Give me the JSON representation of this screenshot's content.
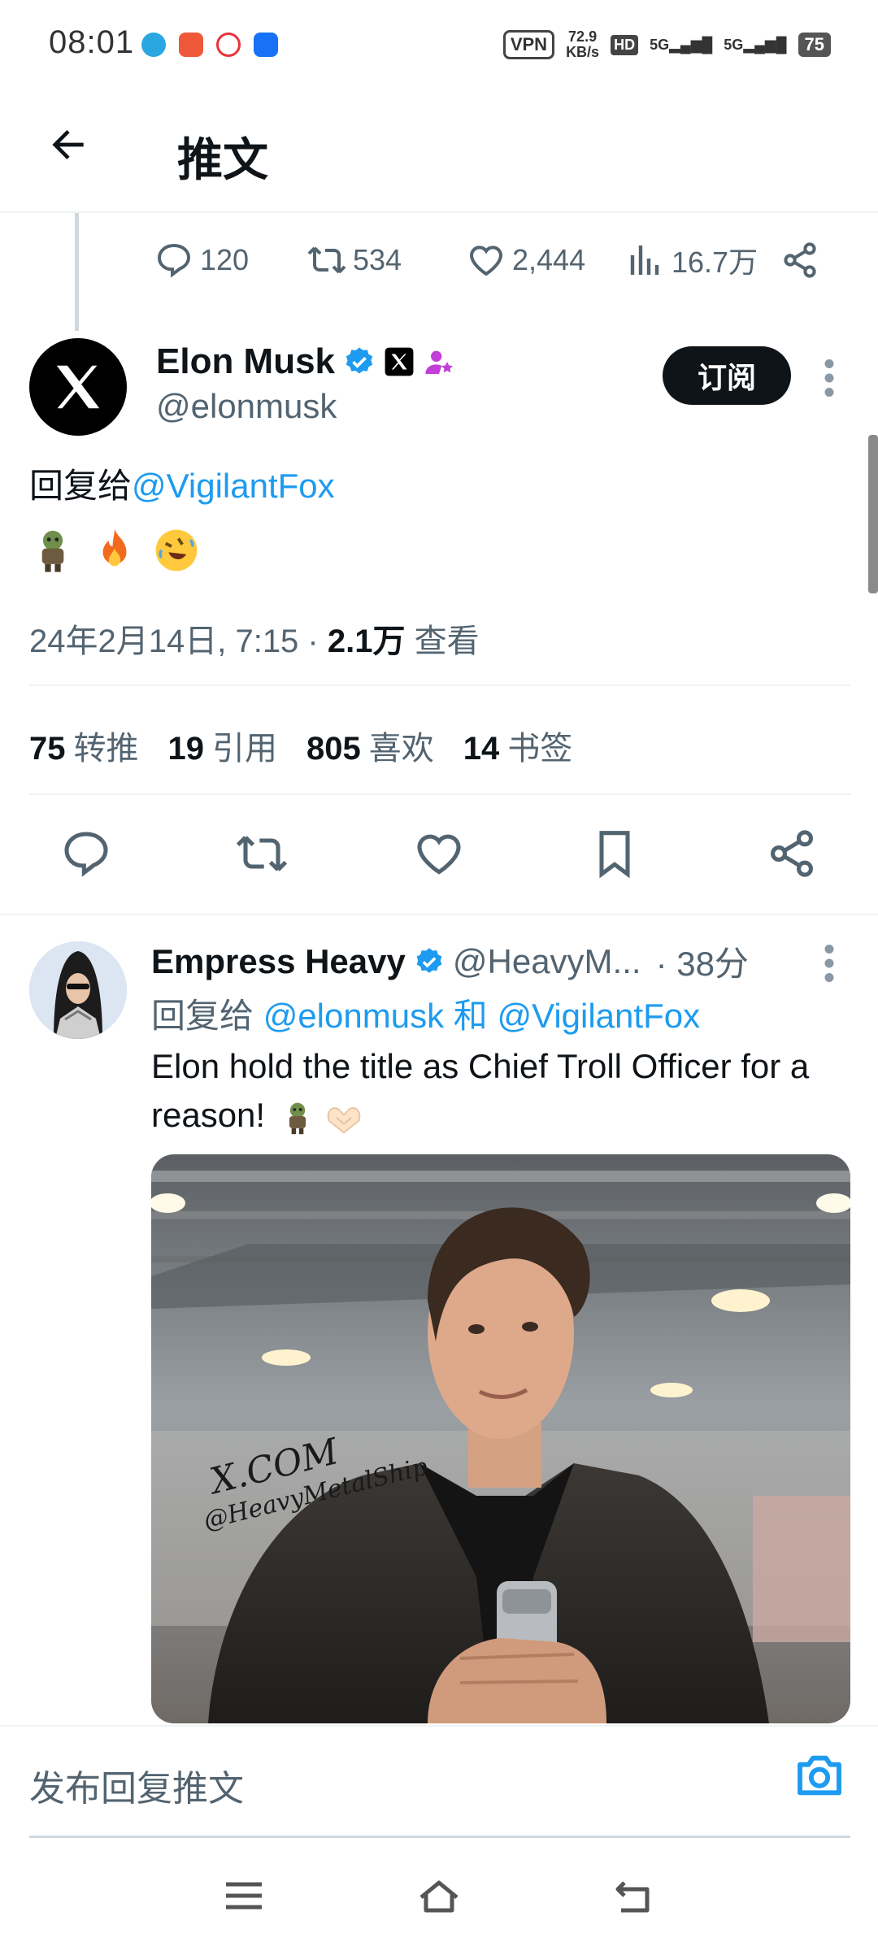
{
  "status_bar": {
    "time": "08:01",
    "vpn": "VPN",
    "speed_value": "72.9",
    "speed_unit": "KB/s",
    "hd": "HD",
    "net1": "5G",
    "net2": "5G",
    "battery": "75"
  },
  "header": {
    "title": "推文"
  },
  "parent_tweet_actions": {
    "replies": "120",
    "retweets": "534",
    "likes": "2,444",
    "views": "16.7万"
  },
  "tweet": {
    "author_name": "Elon Musk",
    "handle": "@elonmusk",
    "subscribe_label": "订阅",
    "reply_prefix": "回复给",
    "reply_to": "@VigilantFox",
    "emojis": [
      "troll-emoji",
      "fire-emoji",
      "rofl-emoji"
    ],
    "timestamp": "24年2月14日, 7:15 · ",
    "views_count": "2.1万",
    "views_label": "查看",
    "stats": [
      {
        "count": "75",
        "label": "转推"
      },
      {
        "count": "19",
        "label": "引用"
      },
      {
        "count": "805",
        "label": "喜欢"
      },
      {
        "count": "14",
        "label": "书签"
      }
    ]
  },
  "reply": {
    "author_name": "Empress Heavy",
    "handle": "@HeavyM...",
    "time": "· 38分",
    "reply_prefix": "回复给",
    "reply_to_1": "@elonmusk",
    "reply_and": "和",
    "reply_to_2": "@VigilantFox",
    "text": "Elon hold the title as Chief Troll Officer for a reason!",
    "image_watermark_1": "X.COM",
    "image_watermark_2": "@HeavyMetalShip"
  },
  "composer": {
    "placeholder": "发布回复推文"
  },
  "colors": {
    "accent": "#1d9bf0",
    "text": "#0f1419",
    "muted": "#536471"
  }
}
